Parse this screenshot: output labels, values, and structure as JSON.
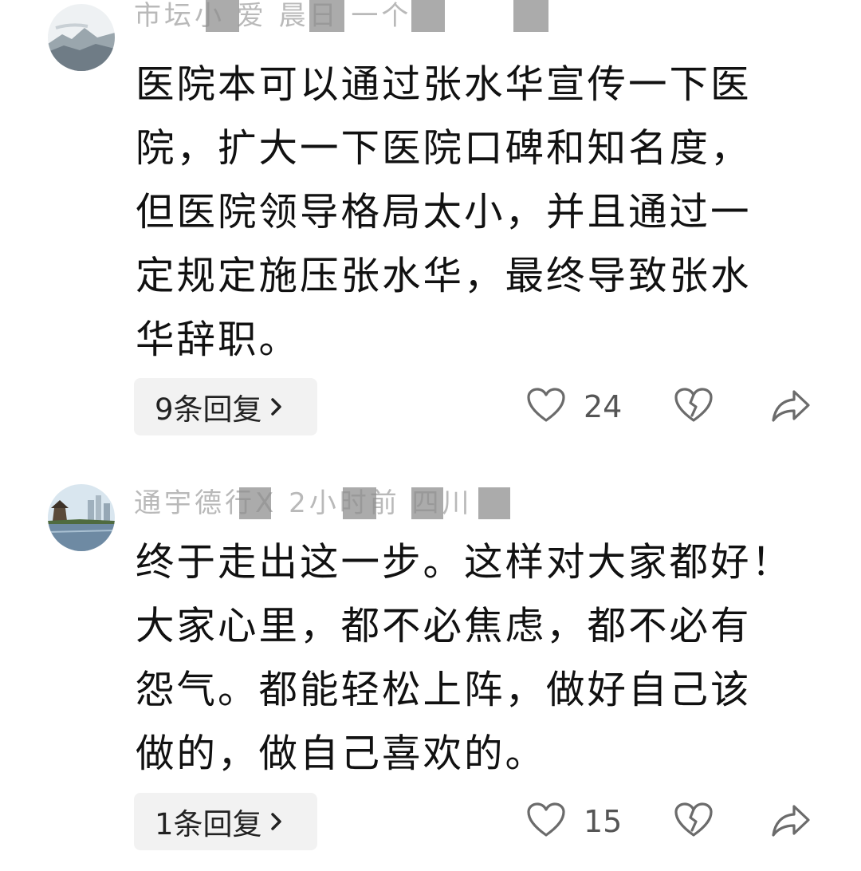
{
  "comments": [
    {
      "username": "市坛小 爱 晨日 一个",
      "text": "医院本可以通过张水华宣传一下医院，扩大一下医院口碑和知名度，但医院领导格局太小，并且通过一定规定施压张水华，最终导致张水华辞职。",
      "display_text": "医院本可以通过张水华宣传一下医\n院，扩大一下医院口碑和知名度，\n但医院领导格局太小，并且通过一\n定规定施压张水华，最终导致张水\n华辞职。",
      "reply_label": "9条回复",
      "like_count": "24",
      "avatar": "landscape-mountain-mist"
    },
    {
      "username": "通宇德行X 2小时前 四川",
      "text": "终于走出这一步。这样对大家都好！大家心里，都不必焦虑，都不必有怨气。都能轻松上阵，做好自己该做的，做自己喜欢的。",
      "display_text": "终于走出这一步。这样对大家都好！\n大家心里，都不必焦虑，都不必有\n怨气。都能轻松上阵，做好自己该\n做的，做自己喜欢的。",
      "reply_label": "1条回复",
      "like_count": "15",
      "avatar": "riverside-pavilion"
    }
  ],
  "icons": {
    "reply_chevron": "chevron-right-icon",
    "like": "heart-outline-icon",
    "dislike": "broken-heart-icon",
    "share": "share-arrow-icon"
  },
  "colors": {
    "reply_bg": "#f2f2f2",
    "icon_stroke": "#6b6b6b",
    "text": "#111111"
  }
}
